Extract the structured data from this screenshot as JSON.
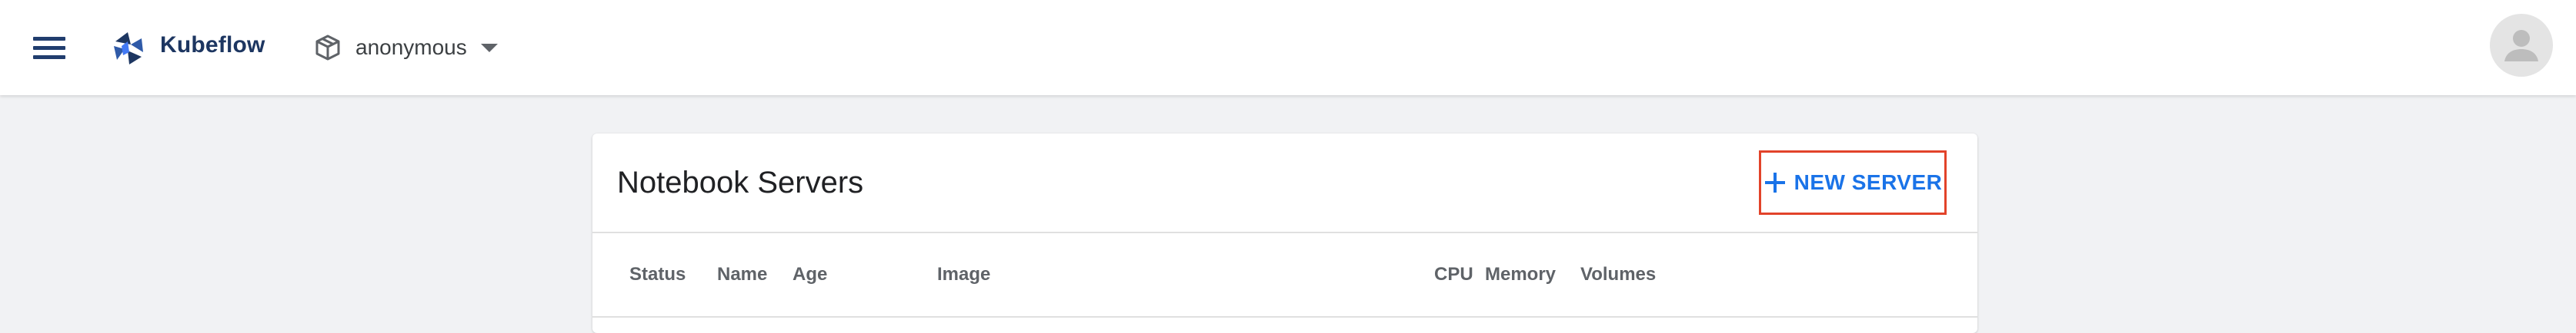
{
  "app": {
    "brand": "Kubeflow",
    "namespace": "anonymous"
  },
  "icons": {
    "menu": "menu-icon",
    "logo": "kubeflow-logo-icon",
    "namespace": "cube-icon",
    "namespace_caret": "caret-down-icon",
    "avatar": "account-circle-icon",
    "add": "plus-icon"
  },
  "colors": {
    "accent": "#1a73e8",
    "brand": "#1d3661",
    "highlight_border": "#e2432a"
  },
  "card": {
    "title": "Notebook Servers",
    "new_server_label": "NEW SERVER"
  },
  "table": {
    "columns": [
      "Status",
      "Name",
      "Age",
      "Image",
      "CPU",
      "Memory",
      "Volumes"
    ]
  }
}
